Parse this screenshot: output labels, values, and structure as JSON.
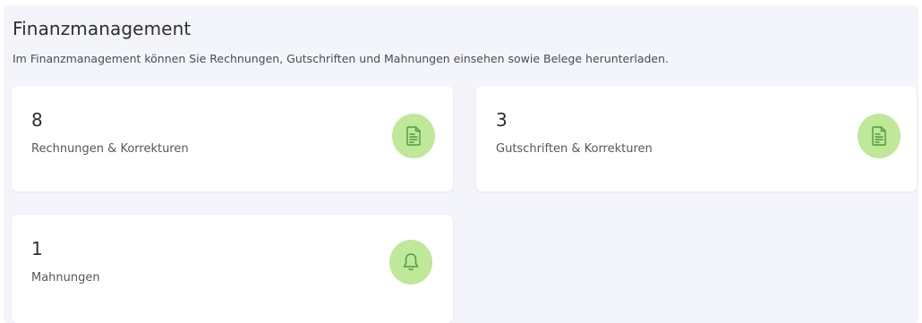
{
  "header": {
    "title": "Finanzmanagement",
    "description": "Im Finanzmanagement können Sie Rechnungen, Gutschriften und Mahnungen einsehen sowie Belege herunterladen."
  },
  "cards": [
    {
      "count": "8",
      "label": "Rechnungen & Korrekturen",
      "icon": "document-icon"
    },
    {
      "count": "3",
      "label": "Gutschriften & Korrekturen",
      "icon": "document-icon"
    },
    {
      "count": "1",
      "label": "Mahnungen",
      "icon": "bell-icon"
    }
  ],
  "colors": {
    "panel_background": "#f4f5fa",
    "card_background": "#ffffff",
    "icon_circle": "#bfe89a",
    "icon_stroke": "#4f9a3d",
    "text_primary": "#2d2e33",
    "text_secondary": "#55575f"
  }
}
